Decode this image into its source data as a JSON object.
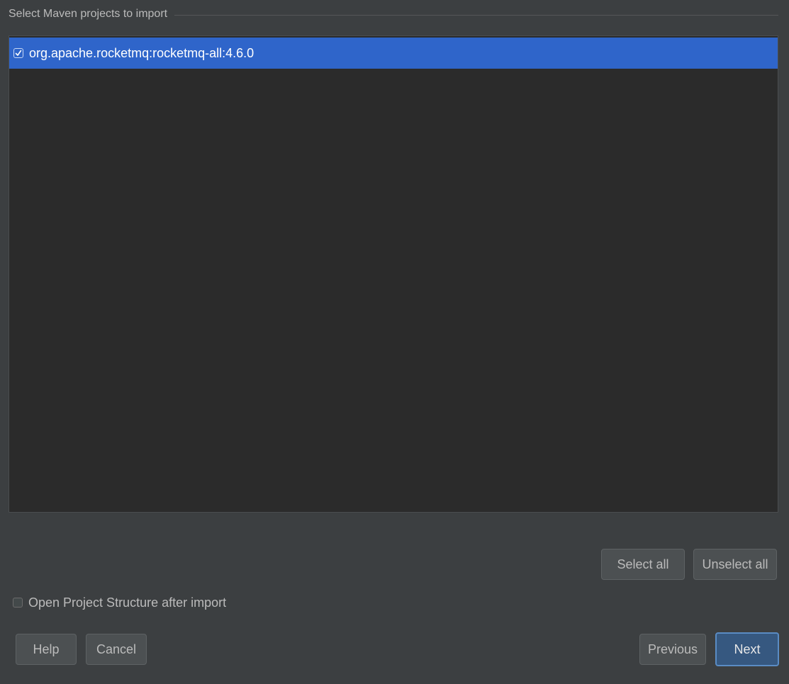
{
  "group": {
    "title": "Select Maven projects to import"
  },
  "projects": [
    {
      "label": "org.apache.rocketmq:rocketmq-all:4.6.0",
      "checked": true,
      "selected": true
    }
  ],
  "list_actions": {
    "select_all_label": "Select all",
    "unselect_all_label": "Unselect all"
  },
  "options": {
    "open_structure_label": "Open Project Structure after import",
    "open_structure_checked": false
  },
  "footer": {
    "help_label": "Help",
    "cancel_label": "Cancel",
    "previous_label": "Previous",
    "next_label": "Next"
  },
  "colors": {
    "background": "#3c3f41",
    "list_background": "#2b2b2b",
    "selection": "#2f65ca",
    "default_button": "#365880",
    "text": "#bbbbbb"
  }
}
